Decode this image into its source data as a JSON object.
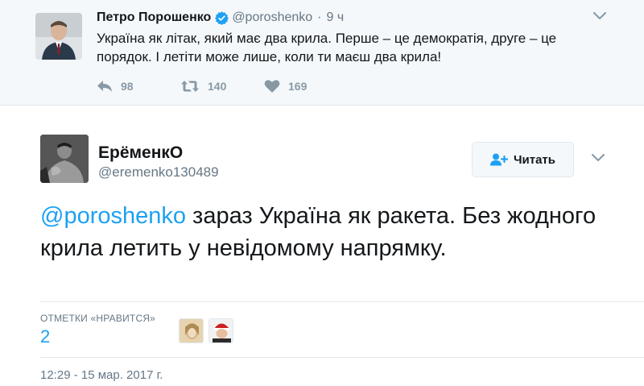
{
  "parent_tweet": {
    "author_name": "Петро Порошенко",
    "author_handle": "@poroshenko",
    "separator": "·",
    "time_ago": "9 ч",
    "text": "Україна як літак, який має два крила. Перше – це демократія, друге – це порядок. І летіти може лише, коли ти маєш два крила!",
    "reply_count": "98",
    "retweet_count": "140",
    "like_count": "169"
  },
  "main_tweet": {
    "author_name": "ЕрёменкО",
    "author_handle": "@eremenko130489",
    "follow_label": "Читать",
    "mention": "@poroshenko",
    "text": " зараз Україна як ракета. Без жодного крила летить у невідомому напрямку.",
    "likes_label": "ОТМЕТКИ «НРАВИТСЯ»",
    "likes_count": "2",
    "timestamp": "12:29 - 15 мар. 2017 г."
  },
  "icons": {
    "verified": "verified-badge-icon",
    "caret": "chevron-down-icon",
    "reply": "reply-icon",
    "retweet": "retweet-icon",
    "like": "heart-icon",
    "follow": "add-user-icon"
  },
  "colors": {
    "accent": "#1da1f2",
    "muted": "#657786",
    "action_gray": "#8899a6",
    "parent_bg": "#f5f8fa"
  }
}
